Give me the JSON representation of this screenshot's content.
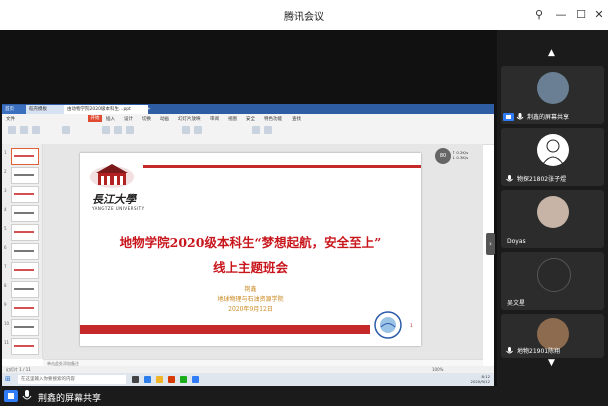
{
  "window": {
    "title": "腾讯会议",
    "controls": [
      "pin",
      "minimize",
      "maximize",
      "close"
    ]
  },
  "shared_screen": {
    "browser_tabs": [
      "首页",
      "稻壳模板",
      "由动物学院2020级本科生…ppt",
      "+"
    ],
    "ribbon_menu": [
      "文件",
      "开始",
      "插入",
      "设计",
      "切换",
      "动画",
      "幻灯片放映",
      "审阅",
      "视图",
      "安全",
      "特色功能",
      "查找"
    ],
    "ribbon_start": "开始",
    "thumbnails": [
      "1",
      "2",
      "3",
      "4",
      "5",
      "6",
      "7",
      "8",
      "9",
      "10",
      "11"
    ],
    "slide": {
      "university_name": "長江大學",
      "university_en": "YANGTZE UNIVERSITY",
      "title_line1": "地物学院2020级本科生“梦想起航，安全至上”",
      "title_line2": "线上主题班会",
      "presenter": "荆鑫",
      "department": "地球物理与石油资源学院",
      "date": "2020年9月12日",
      "page_number": "1"
    },
    "zoom_badge": "80",
    "zoom_stats": [
      "↑ 0.2K/s",
      "↓ 0.3K/s"
    ],
    "notes_placeholder": "单击此处添加备注",
    "status_text": "幻灯片 1 / 11",
    "zoom_level": "100%",
    "taskbar_search": "在这里输入你要搜索的内容",
    "clock": {
      "time": "8:12",
      "date": "2020/9/12"
    }
  },
  "participants": [
    {
      "name": "荆鑫的屏幕共享",
      "avatar_color": "#6a7f93",
      "share": true
    },
    {
      "name": "物探21802张子煜",
      "avatar_color": "#ffffff"
    },
    {
      "name": "Doyas",
      "avatar_color": "#c7b4a7"
    },
    {
      "name": "吴文星",
      "avatar_color": "#2a2a2a"
    },
    {
      "name": "地物21901陈翔",
      "avatar_color": "#8d6b4f"
    }
  ],
  "bottom_bar": {
    "label": "荆鑫的屏幕共享"
  },
  "colors": {
    "accent_red": "#c8161d",
    "gold": "#c9861b",
    "share_blue": "#2f7cf6"
  }
}
